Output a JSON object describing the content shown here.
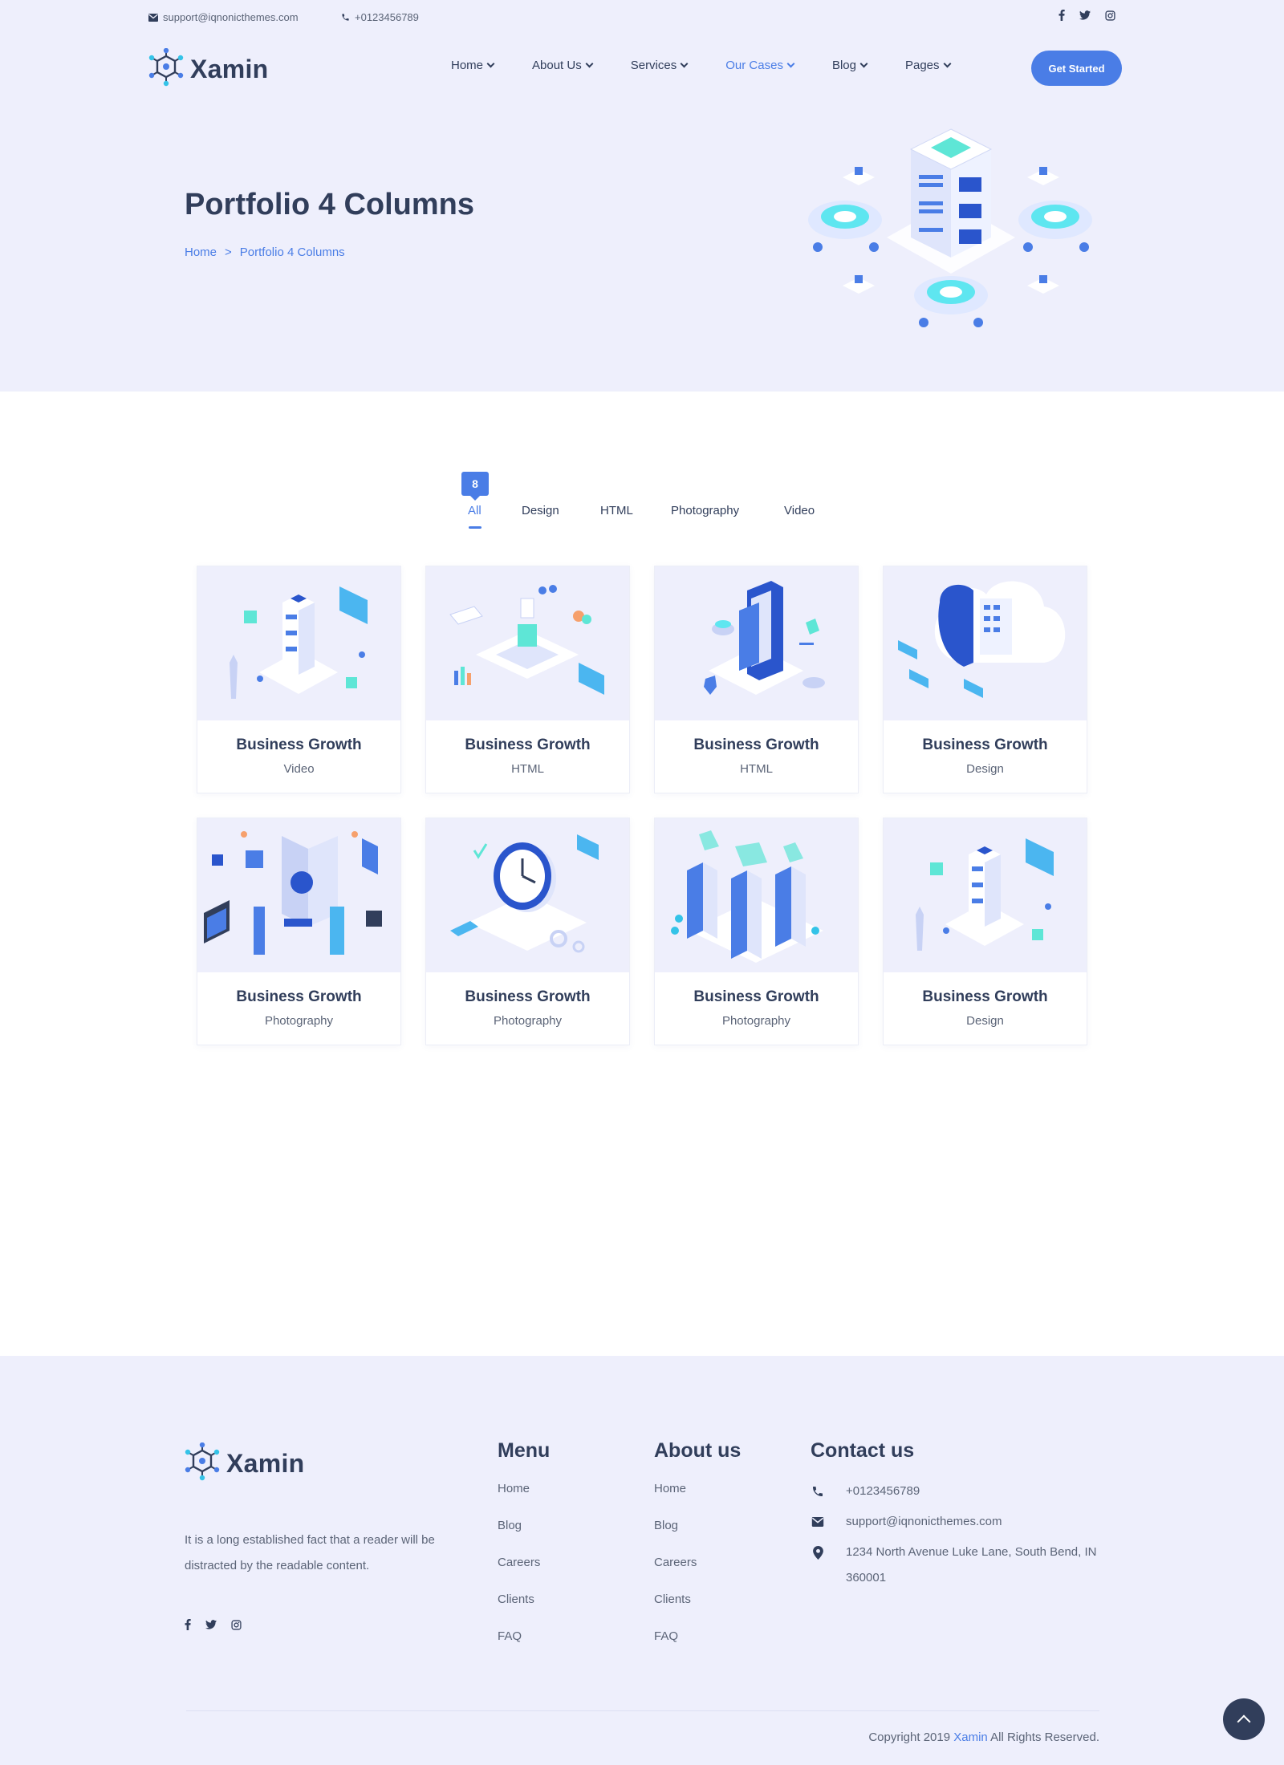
{
  "topbar": {
    "email": "support@iqnonicthemes.com",
    "phone": "+0123456789",
    "social_icons": [
      "facebook-icon",
      "twitter-icon",
      "instagram-icon"
    ]
  },
  "header": {
    "brand": "Xamin",
    "nav": [
      {
        "label": "Home"
      },
      {
        "label": "About Us"
      },
      {
        "label": "Services"
      },
      {
        "label": "Our Cases",
        "active": true
      },
      {
        "label": "Blog"
      },
      {
        "label": "Pages"
      }
    ],
    "cta_label": "Get Started"
  },
  "hero": {
    "title": "Portfolio 4 Columns",
    "breadcrumb_home": "Home",
    "breadcrumb_sep": ">",
    "breadcrumb_current": "Portfolio 4 Columns"
  },
  "filters": {
    "count": "8",
    "items": [
      "All",
      "Design",
      "HTML",
      "Photography",
      "Video"
    ],
    "active": "All"
  },
  "portfolio": [
    {
      "title": "Business Growth",
      "category": "Video"
    },
    {
      "title": "Business Growth",
      "category": "HTML"
    },
    {
      "title": "Business Growth",
      "category": "HTML"
    },
    {
      "title": "Business Growth",
      "category": "Design"
    },
    {
      "title": "Business Growth",
      "category": "Photography"
    },
    {
      "title": "Business Growth",
      "category": "Photography"
    },
    {
      "title": "Business Growth",
      "category": "Photography"
    },
    {
      "title": "Business Growth",
      "category": "Design"
    }
  ],
  "footer": {
    "brand": "Xamin",
    "description": "It is a long established fact that a reader will be distracted by the readable content.",
    "menu_title": "Menu",
    "menu_links": [
      "Home",
      "Blog",
      "Careers",
      "Clients",
      "FAQ"
    ],
    "about_title": "About us",
    "about_links": [
      "Home",
      "Blog",
      "Careers",
      "Clients",
      "FAQ"
    ],
    "contact_title": "Contact us",
    "contact_phone": "+0123456789",
    "contact_email": "support@iqnonicthemes.com",
    "contact_address": "1234 North Avenue Luke Lane, South Bend, IN 360001",
    "copyright_prefix": "Copyright 2019",
    "copyright_brand": "Xamin",
    "copyright_suffix": "All Rights Reserved."
  },
  "colors": {
    "accent": "#4a7de6",
    "text": "#313e5b",
    "light_bg": "#eeeffc"
  }
}
